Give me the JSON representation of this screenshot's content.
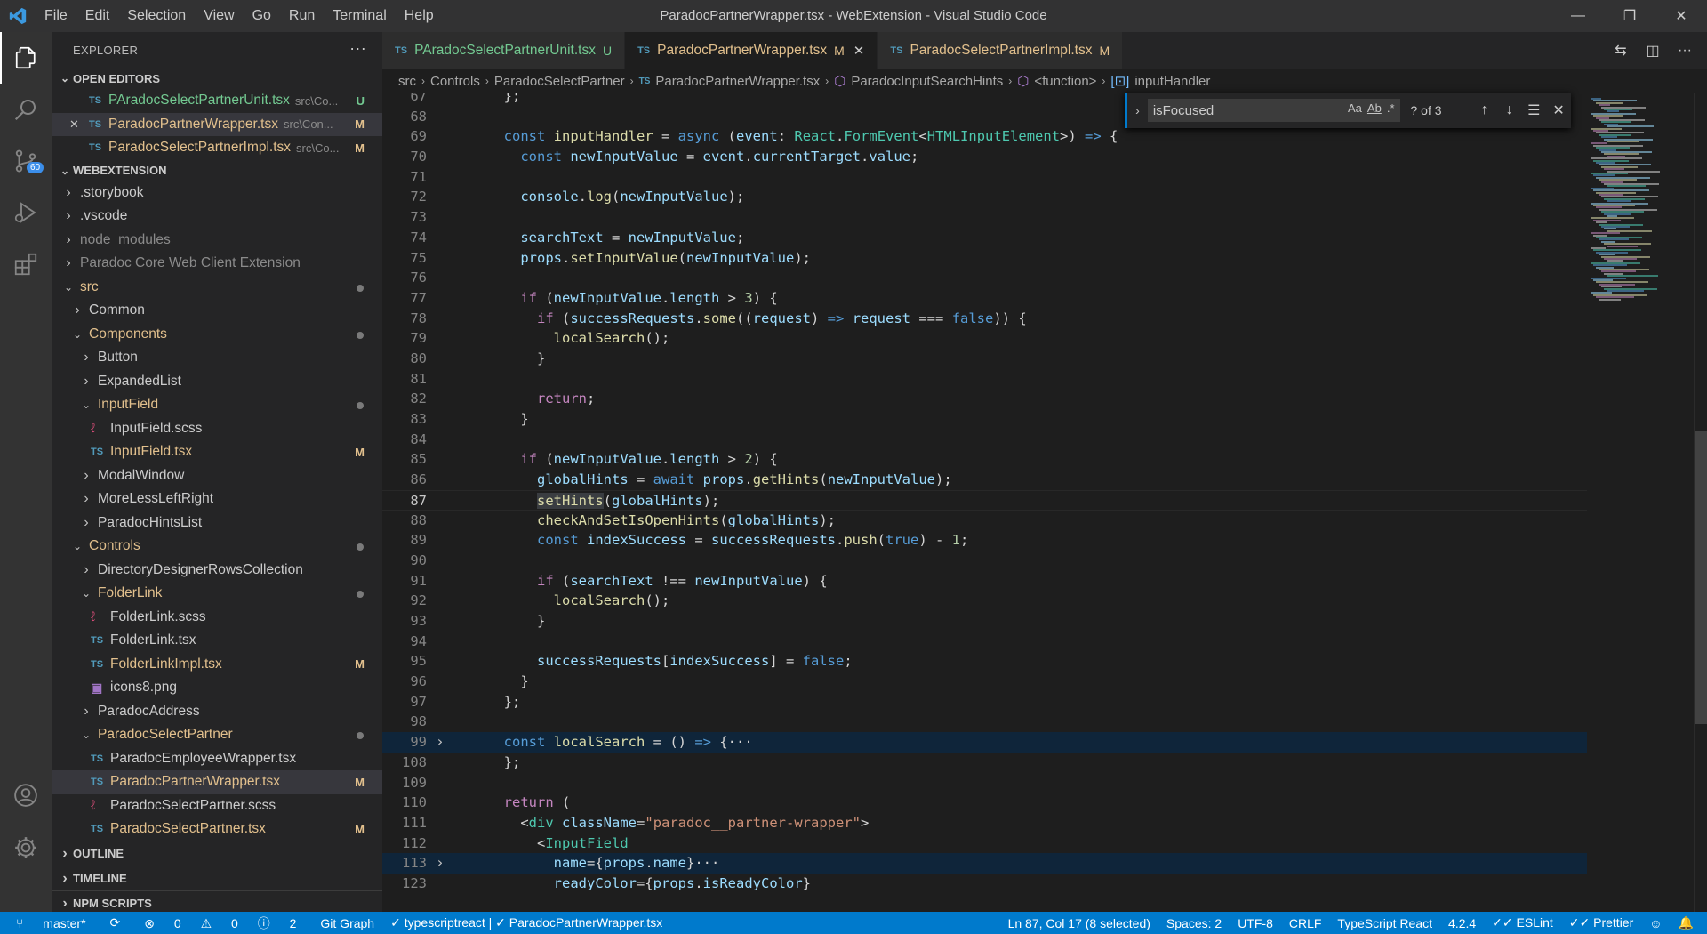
{
  "window": {
    "title": "ParadocPartnerWrapper.tsx - WebExtension - Visual Studio Code",
    "menu": [
      "File",
      "Edit",
      "Selection",
      "View",
      "Go",
      "Run",
      "Terminal",
      "Help"
    ]
  },
  "activity": {
    "scm_badge": "60"
  },
  "explorer": {
    "title": "EXPLORER",
    "open_editors_label": "OPEN EDITORS",
    "open_editors": [
      {
        "name": "PAradocSelectPartnerUnit.tsx",
        "path": "src\\Co...",
        "status": "U",
        "close": ""
      },
      {
        "name": "ParadocPartnerWrapper.tsx",
        "path": "src\\Con...",
        "status": "M",
        "close": "✕"
      },
      {
        "name": "ParadocSelectPartnerImpl.tsx",
        "path": "src\\Co...",
        "status": "M",
        "close": ""
      }
    ],
    "workspace_label": "WEBEXTENSION",
    "tree": [
      {
        "name": ".storybook",
        "kind": "folder-closed",
        "depth": 0,
        "status": "",
        "color": "normal"
      },
      {
        "name": ".vscode",
        "kind": "folder-closed",
        "depth": 0,
        "status": "",
        "color": "normal"
      },
      {
        "name": "node_modules",
        "kind": "folder-closed",
        "depth": 0,
        "status": "",
        "color": "dim"
      },
      {
        "name": "Paradoc Core Web Client Extension",
        "kind": "folder-closed",
        "depth": 0,
        "status": "",
        "color": "dim"
      },
      {
        "name": "src",
        "kind": "folder-open",
        "depth": 0,
        "status": "dot",
        "color": "mod"
      },
      {
        "name": "Common",
        "kind": "folder-closed",
        "depth": 1,
        "status": "",
        "color": "normal"
      },
      {
        "name": "Components",
        "kind": "folder-open",
        "depth": 1,
        "status": "dot",
        "color": "mod"
      },
      {
        "name": "Button",
        "kind": "folder-closed",
        "depth": 2,
        "status": "",
        "color": "normal"
      },
      {
        "name": "ExpandedList",
        "kind": "folder-closed",
        "depth": 2,
        "status": "",
        "color": "normal"
      },
      {
        "name": "InputField",
        "kind": "folder-open",
        "depth": 2,
        "status": "dot",
        "color": "mod"
      },
      {
        "name": "InputField.scss",
        "kind": "scss",
        "depth": 3,
        "status": "",
        "color": "normal"
      },
      {
        "name": "InputField.tsx",
        "kind": "ts",
        "depth": 3,
        "status": "M",
        "color": "mod"
      },
      {
        "name": "ModalWindow",
        "kind": "folder-closed",
        "depth": 2,
        "status": "",
        "color": "normal"
      },
      {
        "name": "MoreLessLeftRight",
        "kind": "folder-closed",
        "depth": 2,
        "status": "",
        "color": "normal"
      },
      {
        "name": "ParadocHintsList",
        "kind": "folder-closed",
        "depth": 2,
        "status": "",
        "color": "normal"
      },
      {
        "name": "Controls",
        "kind": "folder-open",
        "depth": 1,
        "status": "dot",
        "color": "mod"
      },
      {
        "name": "DirectoryDesignerRowsCollection",
        "kind": "folder-closed",
        "depth": 2,
        "status": "",
        "color": "normal"
      },
      {
        "name": "FolderLink",
        "kind": "folder-open",
        "depth": 2,
        "status": "dot",
        "color": "mod"
      },
      {
        "name": "FolderLink.scss",
        "kind": "scss",
        "depth": 3,
        "status": "",
        "color": "normal"
      },
      {
        "name": "FolderLink.tsx",
        "kind": "ts",
        "depth": 3,
        "status": "",
        "color": "normal"
      },
      {
        "name": "FolderLinkImpl.tsx",
        "kind": "ts",
        "depth": 3,
        "status": "M",
        "color": "mod"
      },
      {
        "name": "icons8.png",
        "kind": "png",
        "depth": 3,
        "status": "",
        "color": "normal"
      },
      {
        "name": "ParadocAddress",
        "kind": "folder-closed",
        "depth": 2,
        "status": "",
        "color": "normal"
      },
      {
        "name": "ParadocSelectPartner",
        "kind": "folder-open",
        "depth": 2,
        "status": "dot",
        "color": "mod"
      },
      {
        "name": "ParadocEmployeeWrapper.tsx",
        "kind": "ts",
        "depth": 3,
        "status": "",
        "color": "normal"
      },
      {
        "name": "ParadocPartnerWrapper.tsx",
        "kind": "ts",
        "depth": 3,
        "status": "M",
        "color": "mod",
        "selected": true
      },
      {
        "name": "ParadocSelectPartner.scss",
        "kind": "scss",
        "depth": 3,
        "status": "",
        "color": "normal"
      },
      {
        "name": "ParadocSelectPartner.tsx",
        "kind": "ts",
        "depth": 3,
        "status": "M",
        "color": "mod"
      }
    ],
    "bottom_sections": [
      "OUTLINE",
      "TIMELINE",
      "NPM SCRIPTS"
    ]
  },
  "tabs": [
    {
      "label": "PAradocSelectPartnerUnit.tsx",
      "flag": "U",
      "active": false
    },
    {
      "label": "ParadocPartnerWrapper.tsx",
      "flag": "M",
      "active": true
    },
    {
      "label": "ParadocSelectPartnerImpl.tsx",
      "flag": "M",
      "active": false
    }
  ],
  "tab_close": "✕",
  "breadcrumb": {
    "src": "src",
    "controls": "Controls",
    "folder": "ParadocSelectPartner",
    "file": "ParadocPartnerWrapper.tsx",
    "symbol1": "ParadocInputSearchHints",
    "symbol2": "<function>",
    "symbol3": "inputHandler"
  },
  "find": {
    "query": "isFocused",
    "count": "? of 3",
    "opt_case": "Aa",
    "opt_word": "Ab",
    "opt_regex": ".*"
  },
  "editor": {
    "active_line": "87",
    "lines": [
      {
        "n": "67",
        "t": "  };",
        "fold": false
      },
      {
        "n": "68",
        "t": "",
        "fold": false
      },
      {
        "n": "69",
        "t": "  const inputHandler = async (event: React.FormEvent<HTMLInputElement>) => {",
        "fold": false
      },
      {
        "n": "70",
        "t": "    const newInputValue = event.currentTarget.value;",
        "fold": false
      },
      {
        "n": "71",
        "t": "",
        "fold": false
      },
      {
        "n": "72",
        "t": "    console.log(newInputValue);",
        "fold": false
      },
      {
        "n": "73",
        "t": "",
        "fold": false
      },
      {
        "n": "74",
        "t": "    searchText = newInputValue;",
        "fold": false
      },
      {
        "n": "75",
        "t": "    props.setInputValue(newInputValue);",
        "fold": false
      },
      {
        "n": "76",
        "t": "",
        "fold": false
      },
      {
        "n": "77",
        "t": "    if (newInputValue.length > 3) {",
        "fold": false
      },
      {
        "n": "78",
        "t": "      if (successRequests.some((request) => request === false)) {",
        "fold": false
      },
      {
        "n": "79",
        "t": "        localSearch();",
        "fold": false
      },
      {
        "n": "80",
        "t": "      }",
        "fold": false
      },
      {
        "n": "81",
        "t": "",
        "fold": false
      },
      {
        "n": "82",
        "t": "      return;",
        "fold": false
      },
      {
        "n": "83",
        "t": "    }",
        "fold": false
      },
      {
        "n": "84",
        "t": "",
        "fold": false
      },
      {
        "n": "85",
        "t": "    if (newInputValue.length > 2) {",
        "fold": false
      },
      {
        "n": "86",
        "t": "      globalHints = await props.getHints(newInputValue);",
        "fold": false
      },
      {
        "n": "87",
        "t": "      setHints(globalHints);",
        "fold": false
      },
      {
        "n": "88",
        "t": "      checkAndSetIsOpenHints(globalHints);",
        "fold": false
      },
      {
        "n": "89",
        "t": "      const indexSuccess = successRequests.push(true) - 1;",
        "fold": false
      },
      {
        "n": "90",
        "t": "",
        "fold": false
      },
      {
        "n": "91",
        "t": "      if (searchText !== newInputValue) {",
        "fold": false
      },
      {
        "n": "92",
        "t": "        localSearch();",
        "fold": false
      },
      {
        "n": "93",
        "t": "      }",
        "fold": false
      },
      {
        "n": "94",
        "t": "",
        "fold": false
      },
      {
        "n": "95",
        "t": "      successRequests[indexSuccess] = false;",
        "fold": false
      },
      {
        "n": "96",
        "t": "    }",
        "fold": false
      },
      {
        "n": "97",
        "t": "  };",
        "fold": false
      },
      {
        "n": "98",
        "t": "",
        "fold": false
      },
      {
        "n": "99",
        "t": "  const localSearch = () => {···",
        "fold": true
      },
      {
        "n": "108",
        "t": "  };",
        "fold": false
      },
      {
        "n": "109",
        "t": "",
        "fold": false
      },
      {
        "n": "110",
        "t": "  return (",
        "fold": false
      },
      {
        "n": "111",
        "t": "    <div className=\"paradoc__partner-wrapper\">",
        "fold": false
      },
      {
        "n": "112",
        "t": "      <InputField",
        "fold": false
      },
      {
        "n": "113",
        "t": "        name={props.name}···",
        "fold": true
      },
      {
        "n": "123",
        "t": "        readyColor={props.isReadyColor}",
        "fold": false
      }
    ]
  },
  "statusbar": {
    "branch": "master*",
    "sync": "⟳",
    "errors": "0",
    "warnings": "0",
    "info": "2",
    "git_graph": "Git Graph",
    "ts_check": "✓ typescriptreact | ✓ ParadocPartnerWrapper.tsx",
    "position": "Ln 87, Col 17 (8 selected)",
    "spaces": "Spaces: 2",
    "encoding": "UTF-8",
    "eol": "CRLF",
    "language": "TypeScript React",
    "ts_version": "4.2.4",
    "eslint": "✓✓ ESLint",
    "prettier": "✓✓ Prettier"
  }
}
